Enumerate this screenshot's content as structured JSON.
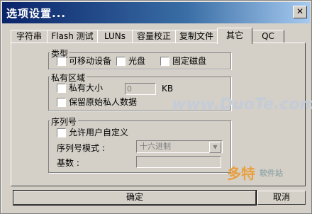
{
  "window": {
    "title": "选项设置..."
  },
  "tabs": [
    "字符串",
    "Flash 测试",
    "LUNs",
    "容量校正",
    "复制文件",
    "其它",
    "QC"
  ],
  "type_group": {
    "label": "类型",
    "options": [
      "可移动设备",
      "光盘",
      "固定磁盘"
    ]
  },
  "private_group": {
    "label": "私有区域",
    "size_label": "私有大小",
    "size_value": "0",
    "size_unit": "KB",
    "keep_label": "保留原始私人数据"
  },
  "serial_group": {
    "label": "序列号",
    "allow_label": "允许用户自定义",
    "mode_label": "序列号模式 :",
    "mode_value": "十六进制",
    "base_label": "基数 :"
  },
  "buttons": {
    "ok": "确定",
    "cancel": "取消"
  },
  "watermarks": {
    "site": "www.DuoTe.com",
    "brand": "多特",
    "brand_sub": "软件站"
  }
}
